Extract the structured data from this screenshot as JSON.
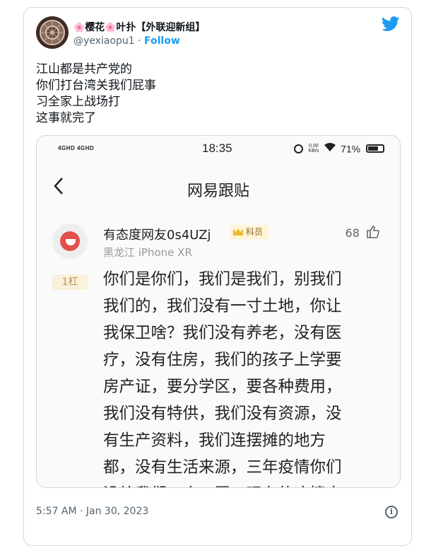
{
  "tweet": {
    "display_name_prefix": "🌸",
    "display_name_a": "樱花",
    "display_name_mid": "🌸",
    "display_name_b": "叶扑【外联迎新组】",
    "handle": "@yexiaopu1",
    "separator": "·",
    "follow_label": "Follow",
    "text_lines": [
      "江山都是共产党的",
      "你们打台湾关我们屁事",
      "习全家上战场打",
      "这事就完了"
    ],
    "timestamp": "5:57 AM · Jan 30, 2023",
    "info_icon_label": "i"
  },
  "screenshot": {
    "status": {
      "network": "4GHD 4GHD",
      "time": "18:35",
      "speed_top": "0.00",
      "speed_bottom": "KB/s",
      "battery": "71%",
      "battery_level": 0.71
    },
    "page_title": "网易跟贴",
    "comment": {
      "username": "有态度网友0s4UZj",
      "member_label": "科员",
      "location": "黑龙江 iPhone XR",
      "likes": "68",
      "floor": "1杠",
      "body_lines": [
        "你们是你们，我们是我们，别我们",
        "我们的，我们没有一寸土地，你让",
        "我保卫啥？我们没有养老，没有医",
        "疗，没有住房，我们的孩子上学要",
        "房产证，要分学区，要各种费用，",
        "我们没有特供，我们没有资源，没",
        "有生产资料，我们连摆摊的地方",
        "都，没有生活来源，三年疫情你们",
        "没给我们一个口罩，现在的疫情大"
      ]
    }
  },
  "colors": {
    "twitter_blue": "#1d9bf0",
    "secondary_text": "#536471",
    "netease_red": "#e2504c"
  }
}
